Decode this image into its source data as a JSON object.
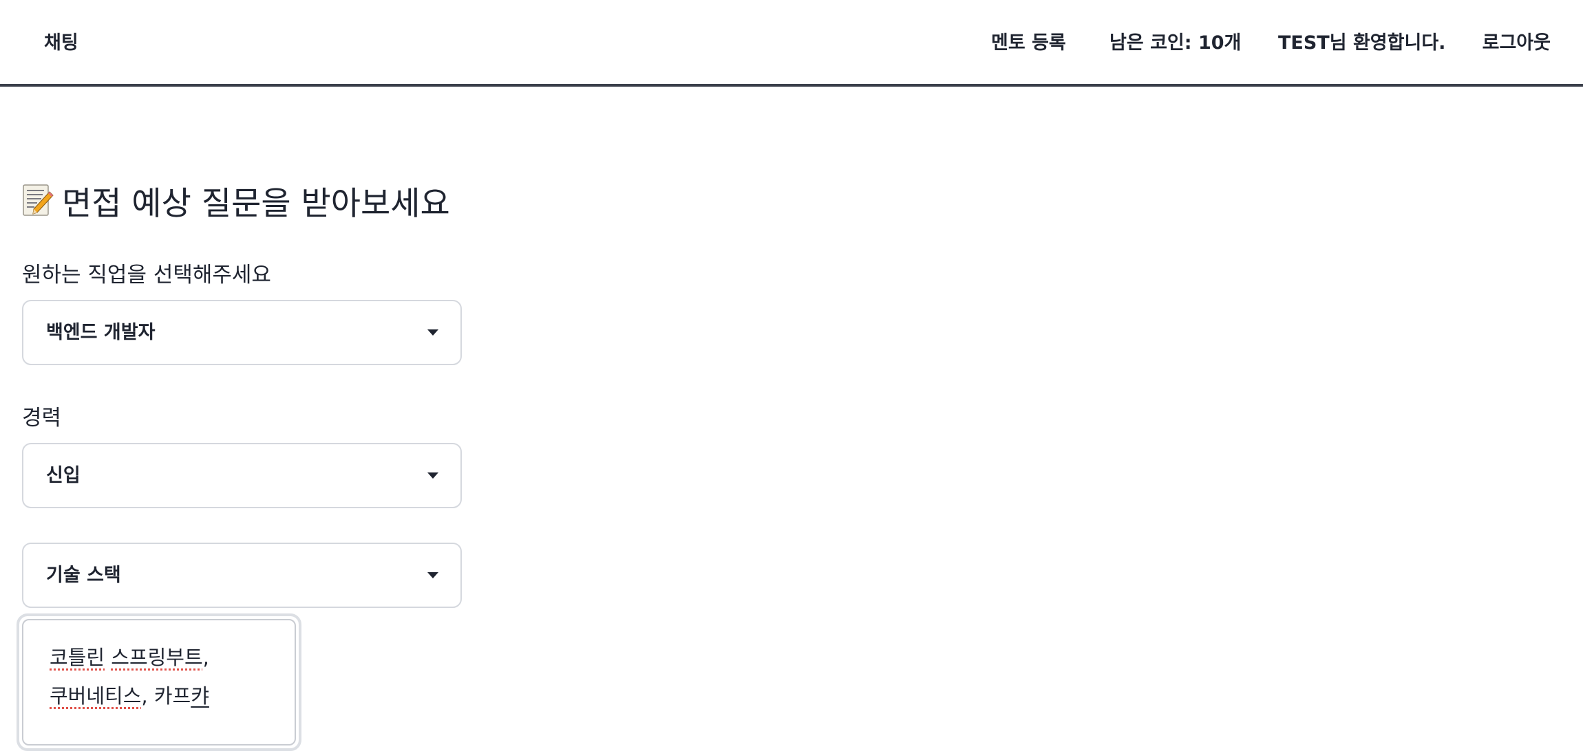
{
  "nav": {
    "chat": "채팅",
    "mentor_register": "멘토 등록",
    "coins": "남은 코인: 10개",
    "welcome": "TEST님 환영합니다.",
    "logout": "로그아웃"
  },
  "main": {
    "title": "면접 예상 질문을 받아보세요",
    "title_icon": "memo-icon",
    "job": {
      "label": "원하는 직업을 선택해주세요",
      "selected": "백엔드 개발자"
    },
    "career": {
      "label": "경력",
      "selected": "신입"
    },
    "tech_stack": {
      "selected": "기술 스택"
    },
    "stack_input": {
      "line1_word1": "코틀린",
      "line1_word2": "스프링부트",
      "line1_sep": ",",
      "line2_word1": "쿠버네티스",
      "line2_sep": ", ",
      "line2_word2": "카프",
      "line2_composing": "캬"
    }
  },
  "colors": {
    "text": "#1f2430",
    "border": "#d5d8de",
    "navbar_border": "#3a3f4a",
    "spellcheck": "#e0524a"
  }
}
